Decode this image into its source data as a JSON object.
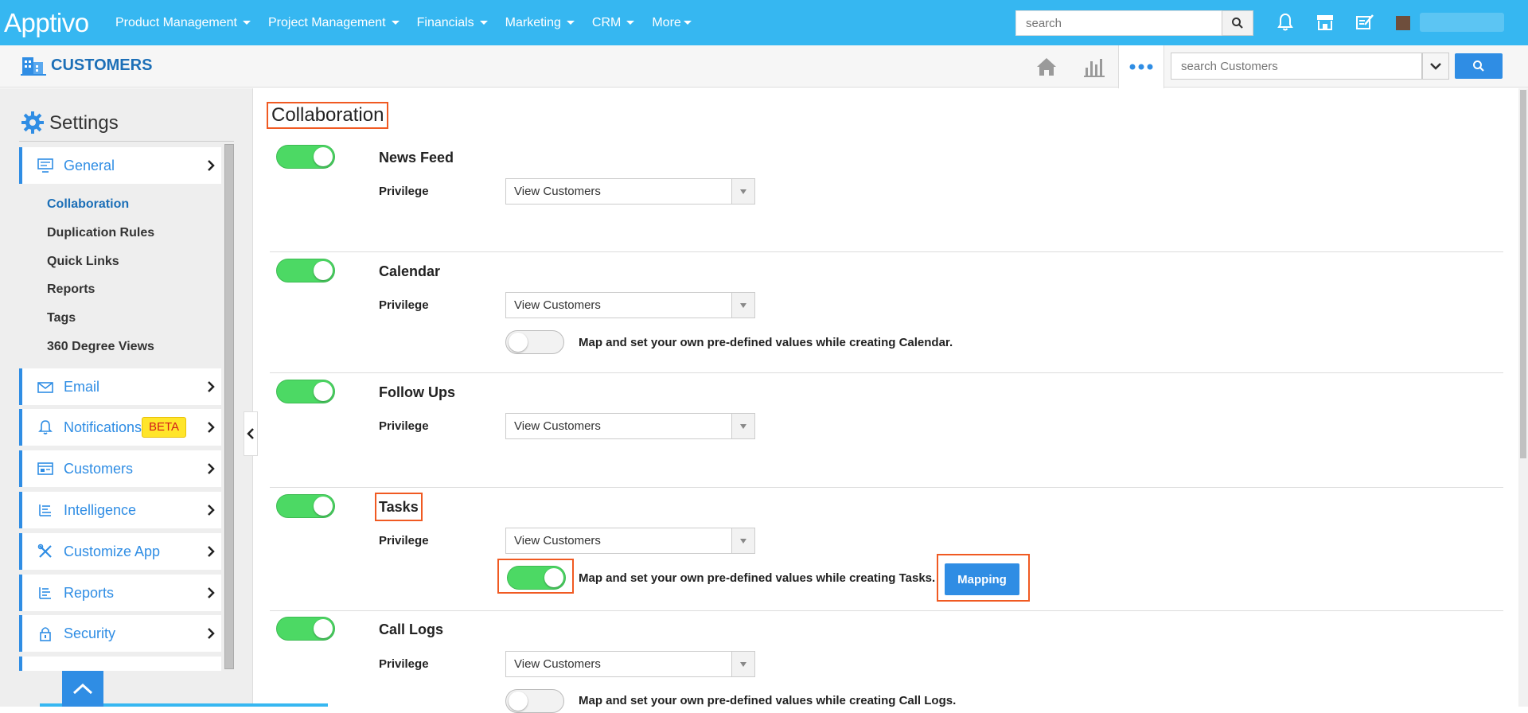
{
  "topbar": {
    "logo": "Apptivo",
    "nav": [
      {
        "label": "Product Management"
      },
      {
        "label": "Project Management"
      },
      {
        "label": "Financials"
      },
      {
        "label": "Marketing"
      },
      {
        "label": "CRM"
      },
      {
        "label": "More"
      }
    ],
    "search_placeholder": "search",
    "icons": [
      "search-icon",
      "bell-icon",
      "store-icon",
      "compose-icon",
      "avatar"
    ]
  },
  "subbar": {
    "app_title": "CUSTOMERS",
    "search_placeholder": "search Customers",
    "icons": [
      "home-icon",
      "bar-chart-icon",
      "more-dots-icon",
      "chevron-down-icon",
      "search-icon"
    ]
  },
  "sidebar": {
    "title": "Settings",
    "items": [
      {
        "label": "General",
        "icon": "monitor-icon"
      },
      {
        "label": "Email",
        "icon": "envelope-icon"
      },
      {
        "label": "Notifications",
        "icon": "bell-icon",
        "badge": "BETA"
      },
      {
        "label": "Customers",
        "icon": "card-icon"
      },
      {
        "label": "Intelligence",
        "icon": "list-icon"
      },
      {
        "label": "Customize App",
        "icon": "tools-icon"
      },
      {
        "label": "Reports",
        "icon": "report-icon"
      },
      {
        "label": "Security",
        "icon": "lock-icon"
      }
    ],
    "general_subitems": [
      {
        "label": "Collaboration",
        "active": true
      },
      {
        "label": "Duplication Rules"
      },
      {
        "label": "Quick Links"
      },
      {
        "label": "Reports"
      },
      {
        "label": "Tags"
      },
      {
        "label": "360 Degree Views"
      }
    ]
  },
  "main": {
    "title": "Collaboration",
    "privilege_label": "Privilege",
    "features": [
      {
        "name": "News Feed",
        "enabled": true,
        "privilege": "View Customers"
      },
      {
        "name": "Calendar",
        "enabled": true,
        "privilege": "View Customers",
        "map_enabled": false,
        "map_text": "Map and set your own pre-defined values while creating Calendar."
      },
      {
        "name": "Follow Ups",
        "enabled": true,
        "privilege": "View Customers"
      },
      {
        "name": "Tasks",
        "enabled": true,
        "privilege": "View Customers",
        "map_enabled": true,
        "map_text": "Map and set your own pre-defined values while creating Tasks.",
        "button": "Mapping"
      },
      {
        "name": "Call Logs",
        "enabled": true,
        "privilege": "View Customers",
        "map_enabled": false,
        "map_text": "Map and set your own pre-defined values while creating Call Logs."
      }
    ]
  },
  "colors": {
    "topbar": "#36b7f1",
    "accent": "#2f8de4",
    "toggle_on": "#4cd964",
    "highlight": "#f05a22",
    "beta_bg": "#ffe52a"
  }
}
